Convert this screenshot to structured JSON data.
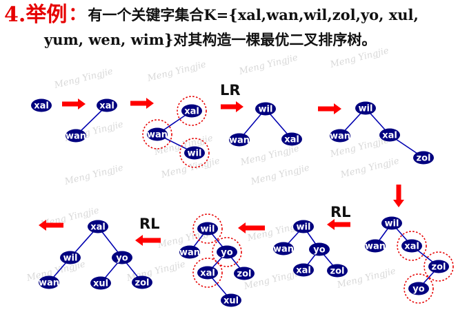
{
  "heading": {
    "number": "4.",
    "word": "举例",
    "colon": "：",
    "line1": "有一个关键字集合K={xal,wan,wil,zol,yo, xul,",
    "line2": "yum, wen, wim}对其构造一棵最优二叉排序树。",
    "accent_color": "#e60000"
  },
  "watermark": "Meng Yingjie",
  "colors": {
    "node_fill": "#00007f",
    "edge": "#0000b0",
    "arrow": "#ff0000",
    "highlight": "#e60000"
  },
  "rotation_labels": [
    "LR",
    "RL",
    "RL"
  ],
  "trees": [
    {
      "id": "step-1",
      "nodes": [
        {
          "label": "xal"
        }
      ],
      "edges": []
    },
    {
      "id": "step-2",
      "nodes": [
        {
          "label": "xal"
        },
        {
          "label": "wan"
        }
      ],
      "edges": [
        [
          0,
          1
        ]
      ]
    },
    {
      "id": "step-3",
      "nodes": [
        {
          "label": "xal",
          "highlight": true
        },
        {
          "label": "wan",
          "highlight": true
        },
        {
          "label": "wil",
          "highlight": true
        }
      ],
      "edges": [
        [
          0,
          1
        ],
        [
          1,
          2
        ]
      ]
    },
    {
      "id": "step-4",
      "nodes": [
        {
          "label": "wil"
        },
        {
          "label": "wan"
        },
        {
          "label": "xal"
        }
      ],
      "edges": [
        [
          0,
          1
        ],
        [
          0,
          2
        ]
      ]
    },
    {
      "id": "step-5",
      "nodes": [
        {
          "label": "wil"
        },
        {
          "label": "wan"
        },
        {
          "label": "xal"
        },
        {
          "label": "zol"
        }
      ],
      "edges": [
        [
          0,
          1
        ],
        [
          0,
          2
        ],
        [
          2,
          3
        ]
      ]
    },
    {
      "id": "step-6",
      "nodes": [
        {
          "label": "wil"
        },
        {
          "label": "wan"
        },
        {
          "label": "xal",
          "highlight": true
        },
        {
          "label": "zol",
          "highlight": true
        },
        {
          "label": "yo",
          "highlight": true
        }
      ],
      "edges": [
        [
          0,
          1
        ],
        [
          0,
          2
        ],
        [
          2,
          3
        ],
        [
          3,
          4
        ]
      ]
    },
    {
      "id": "step-7",
      "nodes": [
        {
          "label": "wil"
        },
        {
          "label": "wan"
        },
        {
          "label": "yo"
        },
        {
          "label": "xal"
        },
        {
          "label": "zol"
        }
      ],
      "edges": [
        [
          0,
          1
        ],
        [
          0,
          2
        ],
        [
          2,
          3
        ],
        [
          2,
          4
        ]
      ]
    },
    {
      "id": "step-8",
      "nodes": [
        {
          "label": "wil",
          "highlight": true
        },
        {
          "label": "wan"
        },
        {
          "label": "yo",
          "highlight": true
        },
        {
          "label": "xal",
          "highlight": true
        },
        {
          "label": "zol"
        },
        {
          "label": "xul"
        }
      ],
      "edges": [
        [
          0,
          1
        ],
        [
          0,
          2
        ],
        [
          2,
          3
        ],
        [
          2,
          4
        ],
        [
          3,
          5
        ]
      ]
    },
    {
      "id": "step-9",
      "nodes": [
        {
          "label": "xal"
        },
        {
          "label": "wil"
        },
        {
          "label": "yo"
        },
        {
          "label": "wan"
        },
        {
          "label": "xul"
        },
        {
          "label": "zol"
        }
      ],
      "edges": [
        [
          0,
          1
        ],
        [
          0,
          2
        ],
        [
          1,
          3
        ],
        [
          2,
          4
        ],
        [
          2,
          5
        ]
      ]
    }
  ]
}
